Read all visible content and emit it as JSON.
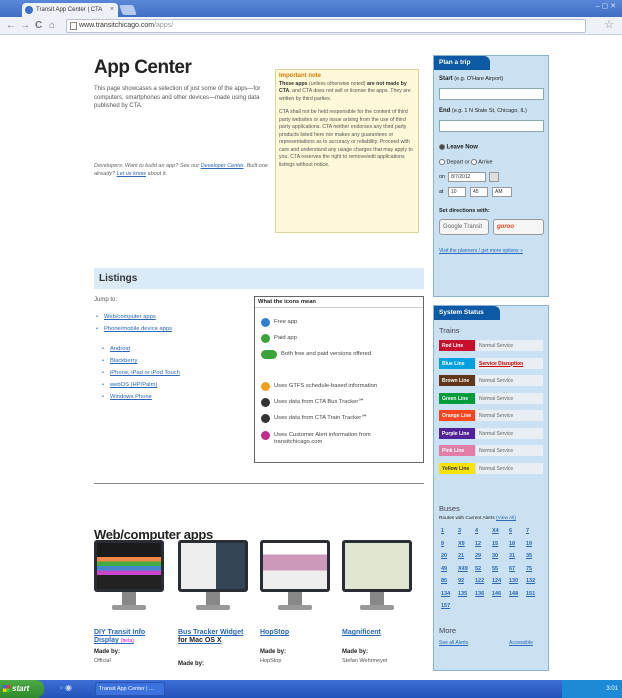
{
  "browser": {
    "tab_title": "Transit App Center | CTA",
    "tab_close": "×",
    "url_host": "www.transitchicago.com",
    "url_path": "/apps/",
    "window_buttons": "– ▢ ✕"
  },
  "page": {
    "title": "App Center",
    "intro": "This page showcases a selection of just some of the apps—for computers, smartphones and other devices—made using data published by CTA.",
    "dev_text_1": "Developers: Want to build an app? See our ",
    "dev_link": "Developer Center",
    "dev_text_2": ". Built one already? ",
    "dev_link2": "Let us know",
    "dev_text_3": " about it.",
    "note": {
      "title": "Important note",
      "bold1": "These apps",
      "text1": " (unless otherwise noted) ",
      "bold2": "are not made by CTA",
      "text2": ", and CTA does not sell or license the apps. They are written by third parties.",
      "para2": "CTA shall not be held responsible for the content of third party websites or any issue arising from the use of third party applications. CTA neither endorses any third party products listed here nor makes any guarantees or representations as to accuracy or reliability. Proceed with care and understand any usage charges that may apply to you. CTA reserves the right to remove/edit applications listings without notice."
    }
  },
  "plan_trip": {
    "header": "Plan a trip",
    "start_label": "Start",
    "start_hint": "(e.g. O'Hare Airport)",
    "end_label": "End",
    "end_hint": "(e.g. 1 N State St, Chicago, IL)",
    "leave_now": "Leave Now",
    "depart": "Depart",
    "or": "or",
    "arrive": "Arrive",
    "on": "on",
    "date": "8/7/2012",
    "at": "at",
    "hour": "10",
    "minute": "45",
    "ampm": "AM",
    "set_dir": "Set directions with:",
    "google": "Google Transit",
    "goroo": "goroo",
    "advanced": "Visit the planners / get more options »"
  },
  "system_status": {
    "header": "System Status",
    "trains_label": "Trains",
    "lines": [
      {
        "name": "Red Line",
        "status": "Normal Service",
        "color": "#c8102e",
        "alert": false
      },
      {
        "name": "Blue Line",
        "status": "Service Disruption",
        "color": "#00a1de",
        "alert": true
      },
      {
        "name": "Brown Line",
        "status": "Normal Service",
        "color": "#62361b",
        "alert": false
      },
      {
        "name": "Green Line",
        "status": "Normal Service",
        "color": "#009b3a",
        "alert": false
      },
      {
        "name": "Orange Line",
        "status": "Normal Service",
        "color": "#f9461c",
        "alert": false
      },
      {
        "name": "Purple Line",
        "status": "Normal Service",
        "color": "#522398",
        "alert": false
      },
      {
        "name": "Pink Line",
        "status": "Normal Service",
        "color": "#e27ea6",
        "alert": false
      },
      {
        "name": "Yellow Line",
        "status": "Normal Service",
        "color": "#f9e300",
        "alert": false
      }
    ],
    "buses_label": "Buses",
    "buses_sub": "Routes with Current Alerts ",
    "buses_sub_link": "(View All)",
    "bus_routes": [
      "1",
      "3",
      "4",
      "X4",
      "6",
      "7",
      "9",
      "X9",
      "12",
      "15",
      "18",
      "19",
      "20",
      "21",
      "29",
      "30",
      "31",
      "35",
      "49",
      "X49",
      "52",
      "55",
      "67",
      "75",
      "85",
      "92",
      "122",
      "124",
      "130",
      "132",
      "134",
      "135",
      "136",
      "146",
      "148",
      "151",
      "157"
    ],
    "more_label": "More",
    "see_all": "See all Alerts",
    "accessible": "Accessible"
  },
  "listings": {
    "header": "Listings",
    "jump_to": "Jump to:",
    "links": [
      {
        "label": "Web/computer apps",
        "level": 0
      },
      {
        "label": "Phone/mobile device apps",
        "level": 0
      },
      {
        "label": "Android",
        "level": 1
      },
      {
        "label": "Blackberry",
        "level": 1
      },
      {
        "label": "iPhone, iPad or iPod Touch",
        "level": 1
      },
      {
        "label": "webOS (HP/Palm)",
        "level": 1
      },
      {
        "label": "Windows Phone",
        "level": 1
      }
    ],
    "icons_box": {
      "title": "What the icons mean",
      "items": [
        {
          "icon": "free-icon",
          "text": "Free app",
          "color": "#2f7fd0"
        },
        {
          "icon": "paid-icon",
          "text": "Paid app",
          "color": "#3aa43a"
        },
        {
          "icon": "free-paid-icon",
          "text": "Both free and paid versions offered",
          "color": "#3aa43a"
        },
        {
          "icon": "gtfs-icon",
          "text": "Uses GTFS schedule-based information",
          "color": "#f0a020"
        },
        {
          "icon": "bus-tracker-icon",
          "text": "Uses data from CTA Bus Tracker℠",
          "color": "#333333"
        },
        {
          "icon": "train-tracker-icon",
          "text": "Uses data from CTA Train Tracker℠",
          "color": "#333333"
        },
        {
          "icon": "customer-alert-icon",
          "text": "Uses Customer Alert information from transitchicago.com",
          "color": "#c02c8e"
        }
      ]
    }
  },
  "web_apps": {
    "header": "Web/computer apps",
    "made_by": "Made by:",
    "apps": [
      {
        "title": "DIY Transit Info Display",
        "badge": "(beta)",
        "suffix": "",
        "maker": "Official"
      },
      {
        "title": "Bus Tracker Widget",
        "badge": "",
        "suffix": " for Mac OS X",
        "maker": ""
      },
      {
        "title": "HopStop",
        "badge": "",
        "suffix": "",
        "maker": "HopStop"
      },
      {
        "title": "Magnificent",
        "badge": "",
        "suffix": "",
        "maker": "Stefan Wehrmeyer"
      }
    ]
  },
  "taskbar": {
    "start": "start",
    "task": "Transit App Center | ...",
    "clock": "3:01"
  }
}
